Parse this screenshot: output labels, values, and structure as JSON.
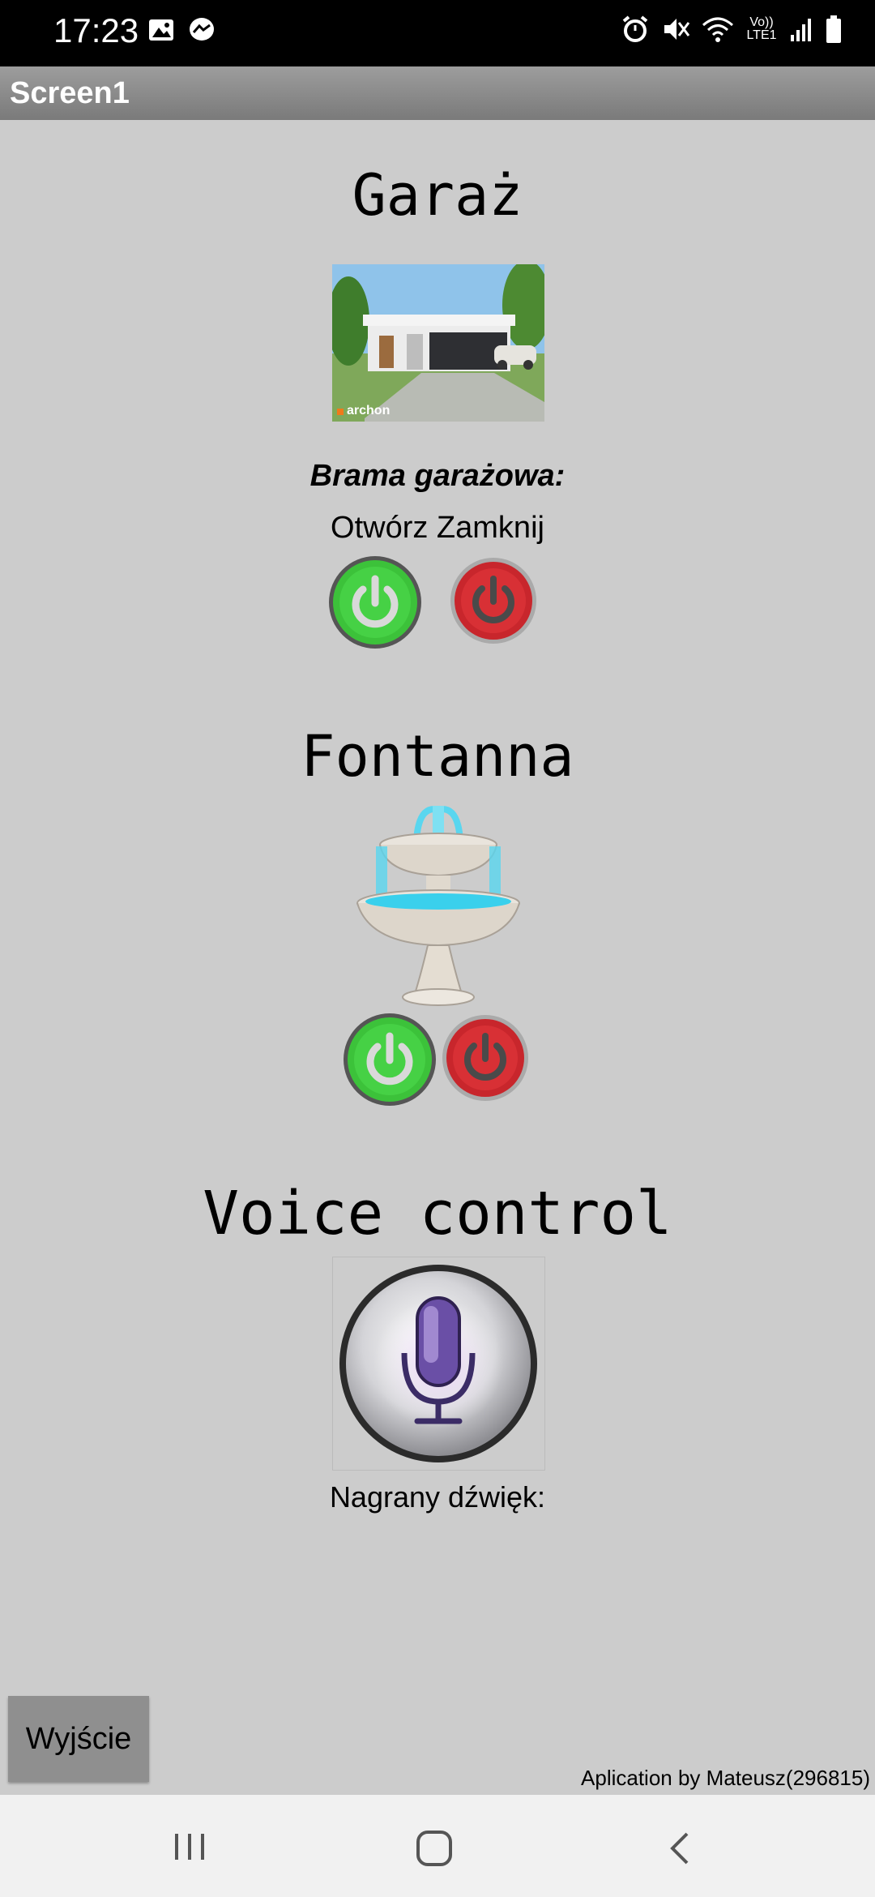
{
  "status_bar": {
    "time": "17:23",
    "network_label": "Vo)) LTE1"
  },
  "app": {
    "title": "Screen1"
  },
  "garage": {
    "heading": "Garaż",
    "image_watermark": "archon",
    "gate_label": "Brama garażowa:",
    "actions_label": "Otwórz Zamknij"
  },
  "fountain": {
    "heading": "Fontanna"
  },
  "voice": {
    "heading": "Voice control",
    "recorded_label": "Nagrany dźwięk:"
  },
  "exit_button": "Wyjście",
  "footer": "Aplication by Mateusz(296815)",
  "colors": {
    "on_green": "#3cc23a",
    "off_red": "#c8262c",
    "title_bar": "#8a8a8a",
    "background": "#cccccc"
  }
}
